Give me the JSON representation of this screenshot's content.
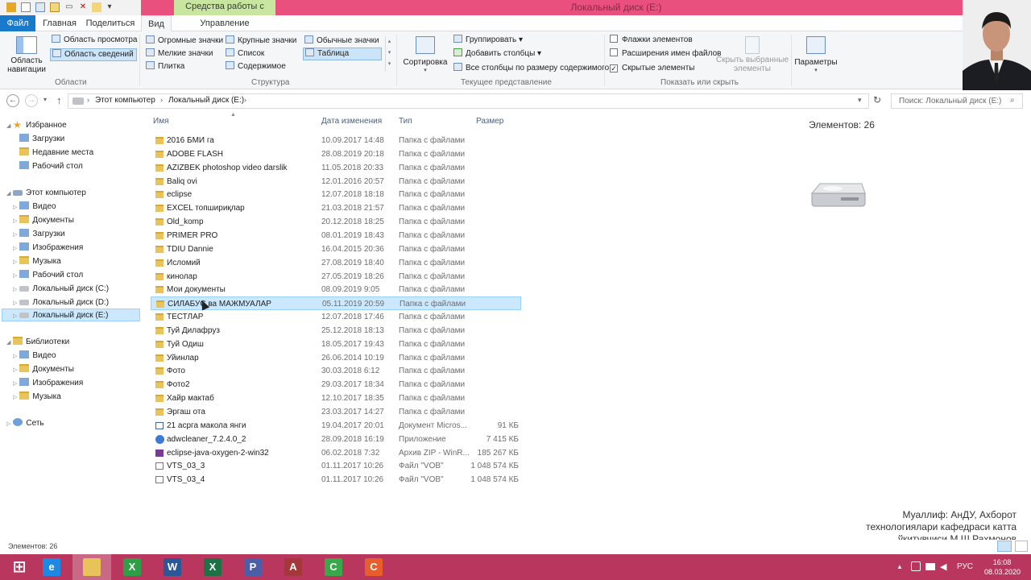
{
  "window": {
    "title": "Локальный диск (E:)",
    "context_tab_title": "Средства работы с дисками"
  },
  "tabs": {
    "file": "Файл",
    "home": "Главная",
    "share": "Поделиться",
    "view": "Вид",
    "manage": "Управление"
  },
  "ribbon": {
    "panes": {
      "nav_pane": "Область навигации",
      "preview_pane": "Область просмотра",
      "details_pane": "Область сведений",
      "group": "Области"
    },
    "layout": {
      "extra_large": "Огромные значки",
      "large": "Крупные значки",
      "medium": "Обычные значки",
      "small": "Мелкие значки",
      "list": "Список",
      "details": "Таблица",
      "tiles": "Плитка",
      "content": "Содержимое",
      "group": "Структура"
    },
    "current_view": {
      "sort_by": "Сортировка",
      "group_by": "Группировать",
      "add_columns": "Добавить столбцы",
      "size_columns": "Все столбцы по размеру содержимого",
      "group": "Текущее представление"
    },
    "show_hide": {
      "item_checkboxes": "Флажки элементов",
      "file_extensions": "Расширения имен файлов",
      "hidden_items": "Скрытые элементы",
      "hidden_items_checked": true,
      "hide_selected": "Скрыть выбранные элементы",
      "group": "Показать или скрыть"
    },
    "options": "Параметры"
  },
  "address": {
    "crumbs": [
      "Этот компьютер",
      "Локальный диск (E:)"
    ],
    "search_placeholder": "Поиск: Локальный диск (E:)"
  },
  "tree": {
    "favorites": "Избранное",
    "fav_items": [
      "Загрузки",
      "Недавние места",
      "Рабочий стол"
    ],
    "this_pc": "Этот компьютер",
    "pc_items": [
      "Видео",
      "Документы",
      "Загрузки",
      "Изображения",
      "Музыка",
      "Рабочий стол",
      "Локальный диск (C:)",
      "Локальный диск (D:)",
      "Локальный диск (E:)"
    ],
    "libraries": "Библиотеки",
    "lib_items": [
      "Видео",
      "Документы",
      "Изображения",
      "Музыка"
    ],
    "network": "Сеть"
  },
  "columns": {
    "name": "Имя",
    "date": "Дата изменения",
    "type": "Тип",
    "size": "Размер"
  },
  "files": [
    {
      "name": "2016 БМИ га",
      "date": "10.09.2017 14:48",
      "type": "Папка с файлами",
      "size": "",
      "kind": "folder"
    },
    {
      "name": "ADOBE FLASH",
      "date": "28.08.2019 20:18",
      "type": "Папка с файлами",
      "size": "",
      "kind": "folder"
    },
    {
      "name": "AZIZBEK photoshop video darslik",
      "date": "11.05.2018 20:33",
      "type": "Папка с файлами",
      "size": "",
      "kind": "folder"
    },
    {
      "name": "Baliq ovi",
      "date": "12.01.2016 20:57",
      "type": "Папка с файлами",
      "size": "",
      "kind": "folder"
    },
    {
      "name": "eclipse",
      "date": "12.07.2018 18:18",
      "type": "Папка с файлами",
      "size": "",
      "kind": "folder"
    },
    {
      "name": "EXCEL топшириқлар",
      "date": "21.03.2018 21:57",
      "type": "Папка с файлами",
      "size": "",
      "kind": "folder"
    },
    {
      "name": "Old_komp",
      "date": "20.12.2018 18:25",
      "type": "Папка с файлами",
      "size": "",
      "kind": "folder"
    },
    {
      "name": "PRIMER PRO",
      "date": "08.01.2019 18:43",
      "type": "Папка с файлами",
      "size": "",
      "kind": "folder"
    },
    {
      "name": "TDIU Dannie",
      "date": "16.04.2015 20:36",
      "type": "Папка с файлами",
      "size": "",
      "kind": "folder"
    },
    {
      "name": "Исломий",
      "date": "27.08.2019 18:40",
      "type": "Папка с файлами",
      "size": "",
      "kind": "folder"
    },
    {
      "name": "кинолар",
      "date": "27.05.2019 18:26",
      "type": "Папка с файлами",
      "size": "",
      "kind": "folder"
    },
    {
      "name": "Мои документы",
      "date": "08.09.2019 9:05",
      "type": "Папка с файлами",
      "size": "",
      "kind": "folder"
    },
    {
      "name": "СИЛАБУС ва МАЖМУАЛАР",
      "date": "05.11.2019 20:59",
      "type": "Папка с файлами",
      "size": "",
      "kind": "folder"
    },
    {
      "name": "ТЕСТЛАР",
      "date": "12.07.2018 17:46",
      "type": "Папка с файлами",
      "size": "",
      "kind": "folder"
    },
    {
      "name": "Туй Дилафруз",
      "date": "25.12.2018 18:13",
      "type": "Папка с файлами",
      "size": "",
      "kind": "folder"
    },
    {
      "name": "Туй Одиш",
      "date": "18.05.2017 19:43",
      "type": "Папка с файлами",
      "size": "",
      "kind": "folder"
    },
    {
      "name": "Уйинлар",
      "date": "26.06.2014 10:19",
      "type": "Папка с файлами",
      "size": "",
      "kind": "folder"
    },
    {
      "name": "Фото",
      "date": "30.03.2018 6:12",
      "type": "Папка с файлами",
      "size": "",
      "kind": "folder"
    },
    {
      "name": "Фото2",
      "date": "29.03.2017 18:34",
      "type": "Папка с файлами",
      "size": "",
      "kind": "folder"
    },
    {
      "name": "Хайр мактаб",
      "date": "12.10.2017 18:35",
      "type": "Папка с файлами",
      "size": "",
      "kind": "folder"
    },
    {
      "name": "Эргаш ота",
      "date": "23.03.2017 14:27",
      "type": "Папка с файлами",
      "size": "",
      "kind": "folder"
    },
    {
      "name": "21 асрга макола янги",
      "date": "19.04.2017 20:01",
      "type": "Документ Micros...",
      "size": "91 КБ",
      "kind": "doc"
    },
    {
      "name": "adwcleaner_7.2.4.0_2",
      "date": "28.09.2018 16:19",
      "type": "Приложение",
      "size": "7 415 КБ",
      "kind": "app"
    },
    {
      "name": "eclipse-java-oxygen-2-win32",
      "date": "06.02.2018 7:32",
      "type": "Архив ZIP - WinR...",
      "size": "185 267 КБ",
      "kind": "zip"
    },
    {
      "name": "VTS_03_3",
      "date": "01.11.2017 10:26",
      "type": "Файл \"VOB\"",
      "size": "1 048 574 КБ",
      "kind": "vob"
    },
    {
      "name": "VTS_03_4",
      "date": "01.11.2017 10:26",
      "type": "Файл \"VOB\"",
      "size": "1 048 574 КБ",
      "kind": "vob"
    }
  ],
  "selected_index": 12,
  "details": {
    "count": "Элементов: 26"
  },
  "watermark": {
    "line1": "Муаллиф: АнДУ, Ахборот",
    "line2": "технологиялари кафедраси катта",
    "line3": "ўқитувчиси М.Ш.Раҳмонов"
  },
  "status": {
    "count": "Элементов: 26"
  },
  "taskbar": {
    "lang": "РУС",
    "time": "16:08",
    "date": "08.03.2020",
    "apps": [
      {
        "icon": "start-icon",
        "color": "#b9375e"
      },
      {
        "icon": "internet-explorer-icon",
        "color": "#1e88e5"
      },
      {
        "icon": "file-explorer-icon",
        "color": "#e8c35a"
      },
      {
        "icon": "project-icon",
        "color": "#2e9e47"
      },
      {
        "icon": "word-icon",
        "color": "#2b5797"
      },
      {
        "icon": "excel-icon",
        "color": "#1e7145"
      },
      {
        "icon": "publisher-icon",
        "color": "#4c5ea8"
      },
      {
        "icon": "access-icon",
        "color": "#a4373a"
      },
      {
        "icon": "camtasia-green-icon",
        "color": "#3aa84a"
      },
      {
        "icon": "camtasia-orange-icon",
        "color": "#e85d2c"
      }
    ]
  }
}
